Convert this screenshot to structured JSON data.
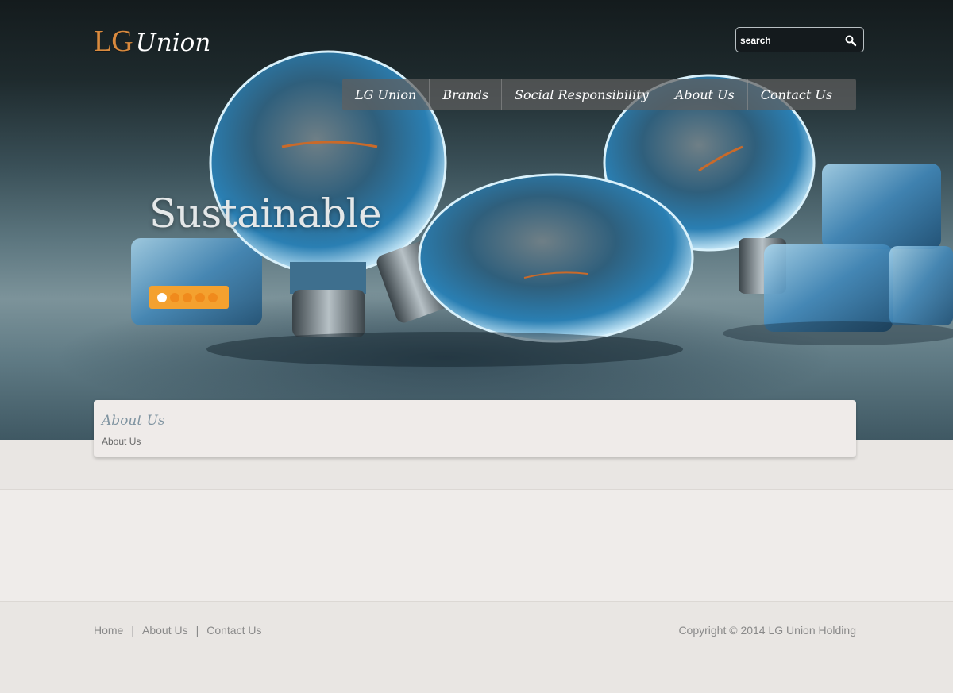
{
  "header": {
    "logo": {
      "part1": "LG",
      "part2": "Union"
    },
    "search": {
      "placeholder": "search",
      "icon": "search-icon"
    }
  },
  "nav": {
    "items": [
      {
        "label": "LG Union"
      },
      {
        "label": "Brands"
      },
      {
        "label": "Social Responsibility"
      },
      {
        "label": "About Us"
      },
      {
        "label": "Contact Us"
      }
    ]
  },
  "hero": {
    "title": "Sustainable",
    "slider": {
      "count": 5,
      "active": 1,
      "accent": "#f4a12f"
    }
  },
  "about": {
    "title": "About Us",
    "breadcrumb": "About Us"
  },
  "footer": {
    "links": [
      {
        "label": "Home"
      },
      {
        "label": "About Us"
      },
      {
        "label": "Contact Us"
      }
    ],
    "separator": "|",
    "copyright": "Copyright © 2014 LG Union Holding"
  }
}
